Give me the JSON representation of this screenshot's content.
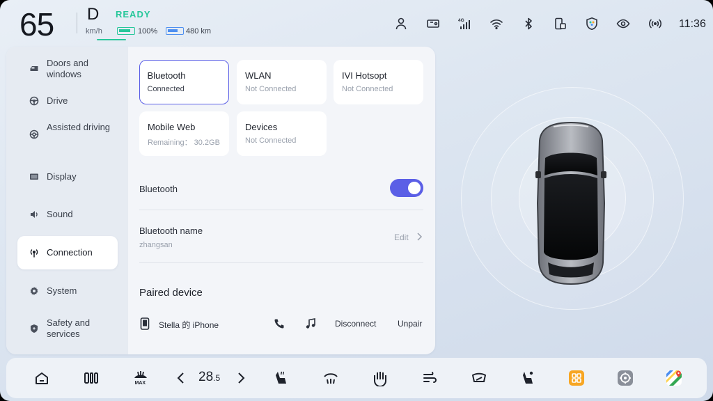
{
  "status": {
    "speed": "65",
    "speed_unit": "km/h",
    "gear": "D",
    "ready": "READY",
    "battery": "100%",
    "range": "480 km",
    "time": "11:36",
    "icons": [
      "person-icon",
      "dashcam-icon",
      "4g-signal-icon",
      "wifi-icon",
      "bluetooth-icon",
      "phone-screen-icon",
      "shield-icon",
      "eye-icon",
      "broadcast-icon"
    ],
    "signal_label": "4G"
  },
  "sidebar": {
    "items": [
      {
        "label": "Doors and windows",
        "icon": "car-door-icon"
      },
      {
        "label": "Drive",
        "icon": "steering-wheel-icon"
      },
      {
        "label": "Assisted driving",
        "icon": "assist-wheel-icon"
      },
      {
        "label": "Display",
        "icon": "display-icon"
      },
      {
        "label": "Sound",
        "icon": "speaker-icon"
      },
      {
        "label": "Connection",
        "icon": "antenna-icon",
        "active": true
      },
      {
        "label": "System",
        "icon": "gear-icon"
      },
      {
        "label": "Safety and services",
        "icon": "shield-icon"
      }
    ]
  },
  "tiles": [
    {
      "title": "Bluetooth",
      "sub": "Connected",
      "active": true
    },
    {
      "title": "WLAN",
      "sub": "Not Connected"
    },
    {
      "title": "IVI Hotsopt",
      "sub": "Not Connected"
    },
    {
      "title": "Mobile Web",
      "sub": "Remaining： 30.2GB"
    },
    {
      "title": "Devices",
      "sub": "Not Connected"
    }
  ],
  "bluetooth": {
    "toggle_label": "Bluetooth",
    "toggle_on": true,
    "name_label": "Bluetooth name",
    "name_value": "zhangsan",
    "edit_label": "Edit"
  },
  "paired": {
    "title": "Paired device",
    "device_name": "Stella 的 iPhone",
    "disconnect_label": "Disconnect",
    "unpair_label": "Unpair"
  },
  "dock": {
    "temperature_int": "28",
    "temperature_dec": ".5",
    "max_label": "MAX",
    "accent": "#f7a623"
  },
  "colors": {
    "accent": "#5b5fe6",
    "ready": "#27c79a",
    "range": "#4d8ff0"
  }
}
